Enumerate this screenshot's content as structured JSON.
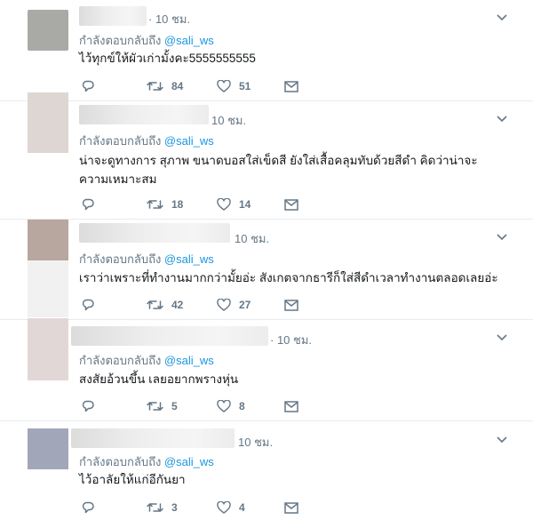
{
  "tweets": [
    {
      "time": "· 10 ชม.",
      "reply_prefix": "กำลังตอบกลับถึง",
      "reply_handle": "@sali_ws",
      "text": "ไว้ทุกข์ให้ผัวเก่ามั้งคะ5555555555",
      "retweets": "84",
      "likes": "51",
      "avatar_color": "#a9aaa6"
    },
    {
      "time": "10 ชม.",
      "reply_prefix": "กำลังตอบกลับถึง",
      "reply_handle": "@sali_ws",
      "text": "น่าจะดูทางการ สุภาพ ขนาดบอสใส่เข็ดสี ยังใส่เสื้อคลุมทับด้วยสีดำ คิดว่าน่าจะความเหมาะสม",
      "retweets": "18",
      "likes": "14",
      "avatar_color": "#ddd6d3"
    },
    {
      "time": "10 ชม.",
      "reply_prefix": "กำลังตอบกลับถึง",
      "reply_handle": "@sali_ws",
      "text": "เราว่าเพราะที่ทำงานมากกว่ามั้ยอ่ะ สังเกตจากธารีก็ใส่สีดำเวลาทำงานตลอดเลยอ่ะ",
      "retweets": "42",
      "likes": "27",
      "avatar_color": "#b7a79e"
    },
    {
      "time": "· 10 ชม.",
      "reply_prefix": "กำลังตอบกลับถึง",
      "reply_handle": "@sali_ws",
      "text": "สงสัยอ้วนขึ้น เลยอยากพรางหุ่น",
      "retweets": "5",
      "likes": "8",
      "avatar_color": "#e2d7d7"
    },
    {
      "time": "10 ชม.",
      "reply_prefix": "กำลังตอบกลับถึง",
      "reply_handle": "@sali_ws",
      "text": "ไว้อาลัยให้แก่อีกันยา",
      "retweets": "3",
      "likes": "4",
      "avatar_color": "#a2a6b9"
    }
  ],
  "colors": {
    "link": "#1b95e0",
    "muted": "#657786",
    "retweet_green": "#17bf63",
    "divider": "#e6ecf0"
  },
  "icons": [
    "reply-icon",
    "retweet-icon",
    "like-icon",
    "direct-message-icon",
    "chevron-down-icon"
  ]
}
